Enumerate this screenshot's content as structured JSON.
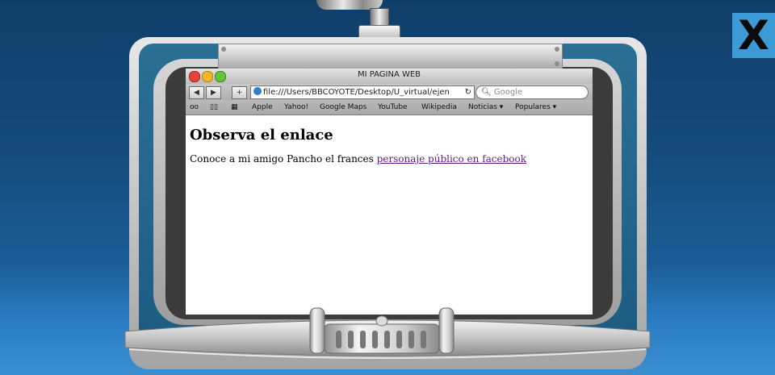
{
  "close_label": "X",
  "browser": {
    "title": "MI PAGINA WEB",
    "url": "file:///Users/BBCOYOTE/Desktop/U_virtual/ejen",
    "search_placeholder": "Google",
    "bookmarks": [
      "Apple",
      "Yahoo!",
      "Google Maps",
      "YouTube",
      "Wikipedia",
      "Noticias ▾",
      "Populares ▾"
    ]
  },
  "page": {
    "heading": "Observa el enlace",
    "text": "Conoce a mi amigo Pancho el frances ",
    "link": "personaje público en facebook"
  },
  "colors": {
    "background": "#154b7c",
    "close_button": "#3c9ad6",
    "frame_teal": "#1d5c82",
    "link": "#5a1e8a"
  }
}
